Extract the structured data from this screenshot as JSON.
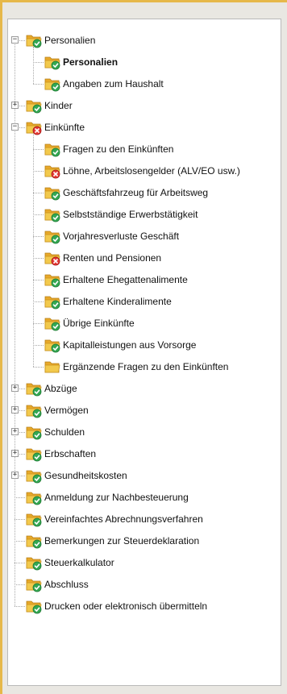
{
  "colors": {
    "frame_accent": "#e6b84a",
    "folder_yellow": "#f2c94c",
    "status_ok": "#34a853",
    "status_error": "#e53935"
  },
  "tree": [
    {
      "label": "Personalien",
      "level": 0,
      "expander": "minus",
      "status": "ok",
      "bold": false
    },
    {
      "label": "Personalien",
      "level": 1,
      "status": "ok",
      "bold": true
    },
    {
      "label": "Angaben zum Haushalt",
      "level": 1,
      "status": "ok",
      "bold": false
    },
    {
      "label": "Kinder",
      "level": 0,
      "expander": "plus",
      "status": "ok",
      "bold": false
    },
    {
      "label": "Einkünfte",
      "level": 0,
      "expander": "minus",
      "status": "error",
      "bold": false
    },
    {
      "label": "Fragen zu den Einkünften",
      "level": 1,
      "status": "ok",
      "bold": false
    },
    {
      "label": "Löhne, Arbeitslosengelder (ALV/EO usw.)",
      "level": 1,
      "status": "error",
      "bold": false
    },
    {
      "label": "Geschäftsfahrzeug für Arbeitsweg",
      "level": 1,
      "status": "ok",
      "bold": false
    },
    {
      "label": "Selbstständige Erwerbstätigkeit",
      "level": 1,
      "status": "ok",
      "bold": false
    },
    {
      "label": "Vorjahresverluste Geschäft",
      "level": 1,
      "status": "ok",
      "bold": false
    },
    {
      "label": "Renten und Pensionen",
      "level": 1,
      "status": "error",
      "bold": false
    },
    {
      "label": "Erhaltene Ehegattenalimente",
      "level": 1,
      "status": "ok",
      "bold": false
    },
    {
      "label": "Erhaltene Kinderalimente",
      "level": 1,
      "status": "ok",
      "bold": false
    },
    {
      "label": "Übrige Einkünfte",
      "level": 1,
      "status": "ok",
      "bold": false
    },
    {
      "label": "Kapitalleistungen aus Vorsorge",
      "level": 1,
      "status": "ok",
      "bold": false
    },
    {
      "label": "Ergänzende Fragen zu den Einkünften",
      "level": 1,
      "status": "none",
      "bold": false
    },
    {
      "label": "Abzüge",
      "level": 0,
      "expander": "plus",
      "status": "ok",
      "bold": false
    },
    {
      "label": "Vermögen",
      "level": 0,
      "expander": "plus",
      "status": "ok",
      "bold": false
    },
    {
      "label": "Schulden",
      "level": 0,
      "expander": "plus",
      "status": "ok",
      "bold": false
    },
    {
      "label": "Erbschaften",
      "level": 0,
      "expander": "plus",
      "status": "ok",
      "bold": false
    },
    {
      "label": "Gesundheitskosten",
      "level": 0,
      "expander": "plus",
      "status": "ok",
      "bold": false
    },
    {
      "label": "Anmeldung zur Nachbesteuerung",
      "level": 0,
      "status": "ok",
      "bold": false
    },
    {
      "label": "Vereinfachtes Abrechnungsverfahren",
      "level": 0,
      "status": "ok",
      "bold": false
    },
    {
      "label": "Bemerkungen zur Steuerdeklaration",
      "level": 0,
      "status": "ok",
      "bold": false
    },
    {
      "label": "Steuerkalkulator",
      "level": 0,
      "status": "ok",
      "bold": false
    },
    {
      "label": "Abschluss",
      "level": 0,
      "status": "ok",
      "bold": false
    },
    {
      "label": "Drucken oder elektronisch übermitteln",
      "level": 0,
      "status": "ok",
      "bold": false
    }
  ]
}
